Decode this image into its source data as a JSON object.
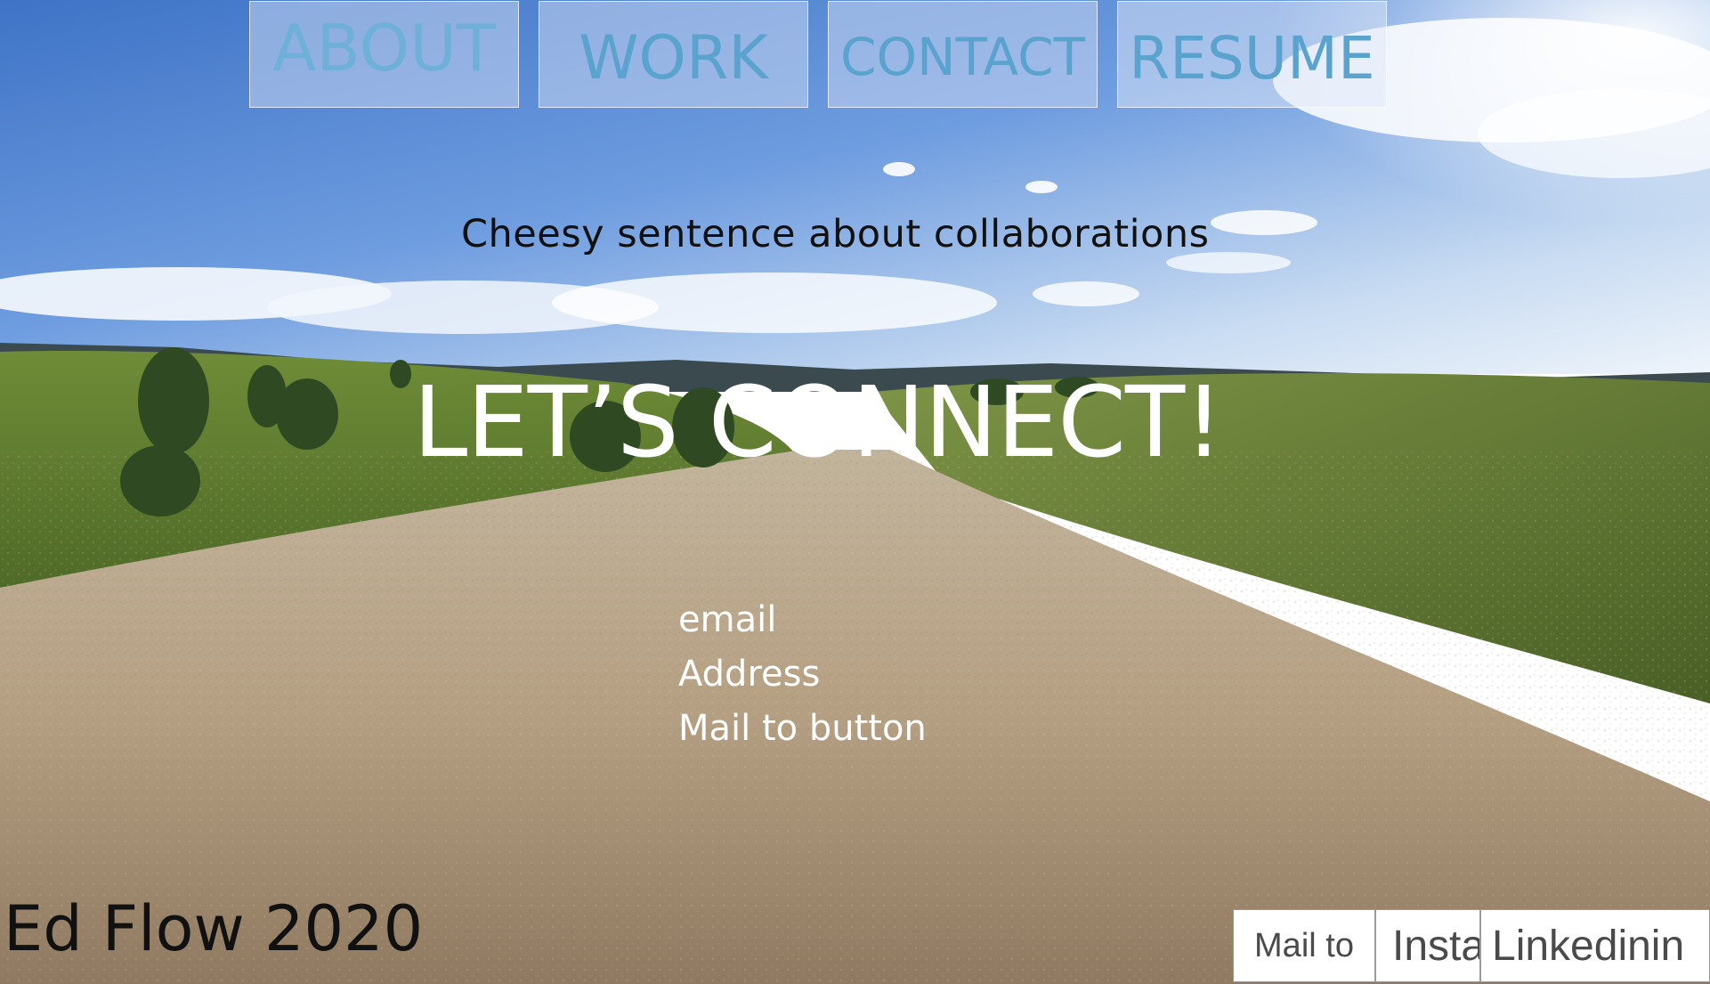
{
  "nav": {
    "about": "ABOUT",
    "work": "WORK",
    "contact": "CONTACT",
    "resume": "RESUME"
  },
  "hero": {
    "tagline": "Cheesy sentence about collaborations",
    "headline": "LET’S CONNECT!",
    "contact_lines": [
      "email",
      "Address",
      "Mail to button"
    ]
  },
  "footer": {
    "brand": "Ed Flow 2020",
    "social": {
      "mailto": "Mail to",
      "insta": "Insta",
      "linkedin": "Linkedinin"
    }
  },
  "colors": {
    "nav_text": "#5aa3cf",
    "headline": "#ffffff",
    "tagline": "#111111",
    "sky": "#4f86d6",
    "grass": "#6e8a3a",
    "road": "#b9a487"
  }
}
